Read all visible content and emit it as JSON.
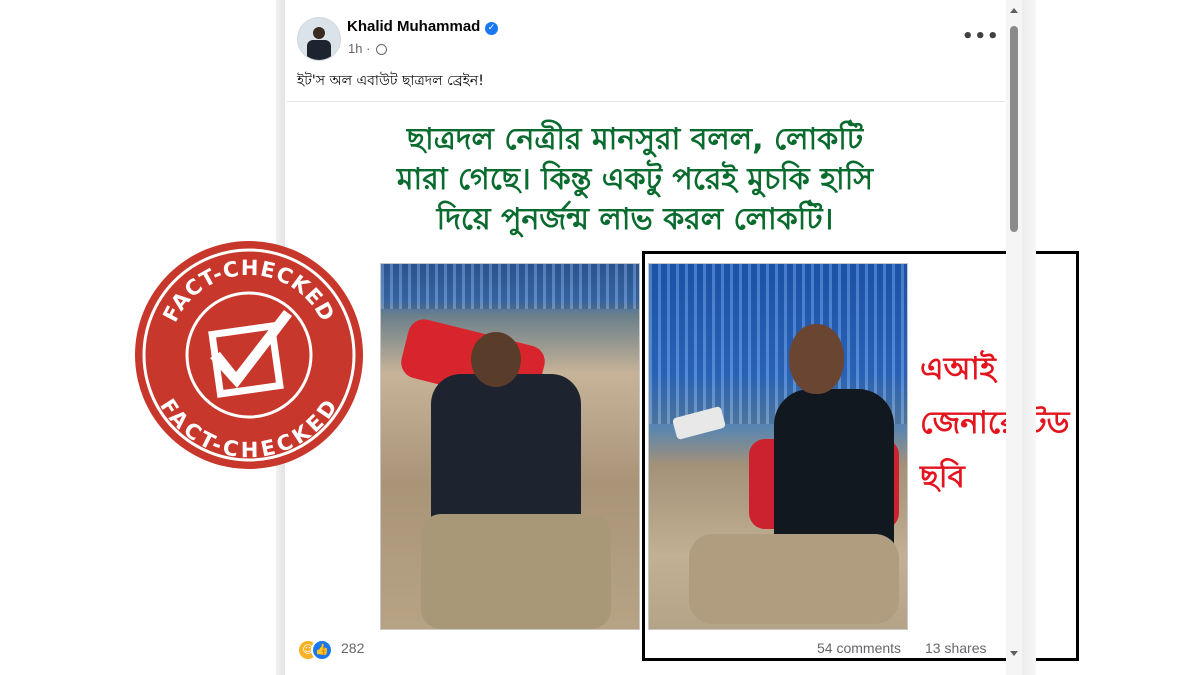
{
  "post": {
    "author": "Khalid Muhammad",
    "verified_icon": "verified-badge-icon",
    "time": "1h ·",
    "caption": "ইট'স অল এবাউট ছাত্রদল ব্রেইন!",
    "more_label": "•••"
  },
  "graphic": {
    "headline_line1": "ছাত্রদল নেত্রীর মানসুরা বলল, লোকটি",
    "headline_line2": "মারা গেছে। কিন্তু একটু পরেই মুচকি হাসি",
    "headline_line3": "দিয়ে পুনর্জন্ম লাভ করল লোকটি।"
  },
  "annotation": {
    "line1": "এআই",
    "line2": "জেনারেটেড",
    "line3": "ছবি",
    "color": "#e3141d"
  },
  "stamp": {
    "text_top": "FACT-CHECKED",
    "text_bottom": "FACT-CHECKED",
    "color": "#c8372b"
  },
  "footer": {
    "reaction_count": "282",
    "comments": "54 comments",
    "shares": "13 shares"
  }
}
